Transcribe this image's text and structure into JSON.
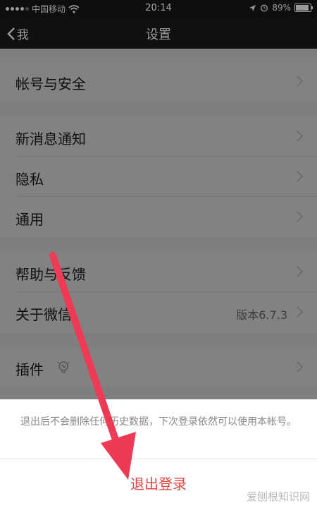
{
  "status_bar": {
    "carrier": "中国移动",
    "time": "20:14",
    "battery": "89%",
    "battery_level": 0.89
  },
  "nav": {
    "back_label": "我",
    "title": "设置"
  },
  "groups": [
    {
      "items": [
        {
          "label": "帐号与安全"
        }
      ]
    },
    {
      "items": [
        {
          "label": "新消息通知"
        },
        {
          "label": "隐私"
        },
        {
          "label": "通用"
        }
      ]
    },
    {
      "items": [
        {
          "label": "帮助与反馈"
        },
        {
          "label": "关于微信",
          "value": "版本6.7.3"
        }
      ]
    },
    {
      "items": [
        {
          "label": "插件"
        }
      ]
    }
  ],
  "sheet": {
    "notice": "退出后不会删除任何历史数据，下次登录依然可以使用本帐号。",
    "logout_label": "退出登录"
  },
  "watermark": "爱刨根知识网",
  "colors": {
    "accent_red": "#e64340",
    "arrow": "#ef3a55"
  }
}
